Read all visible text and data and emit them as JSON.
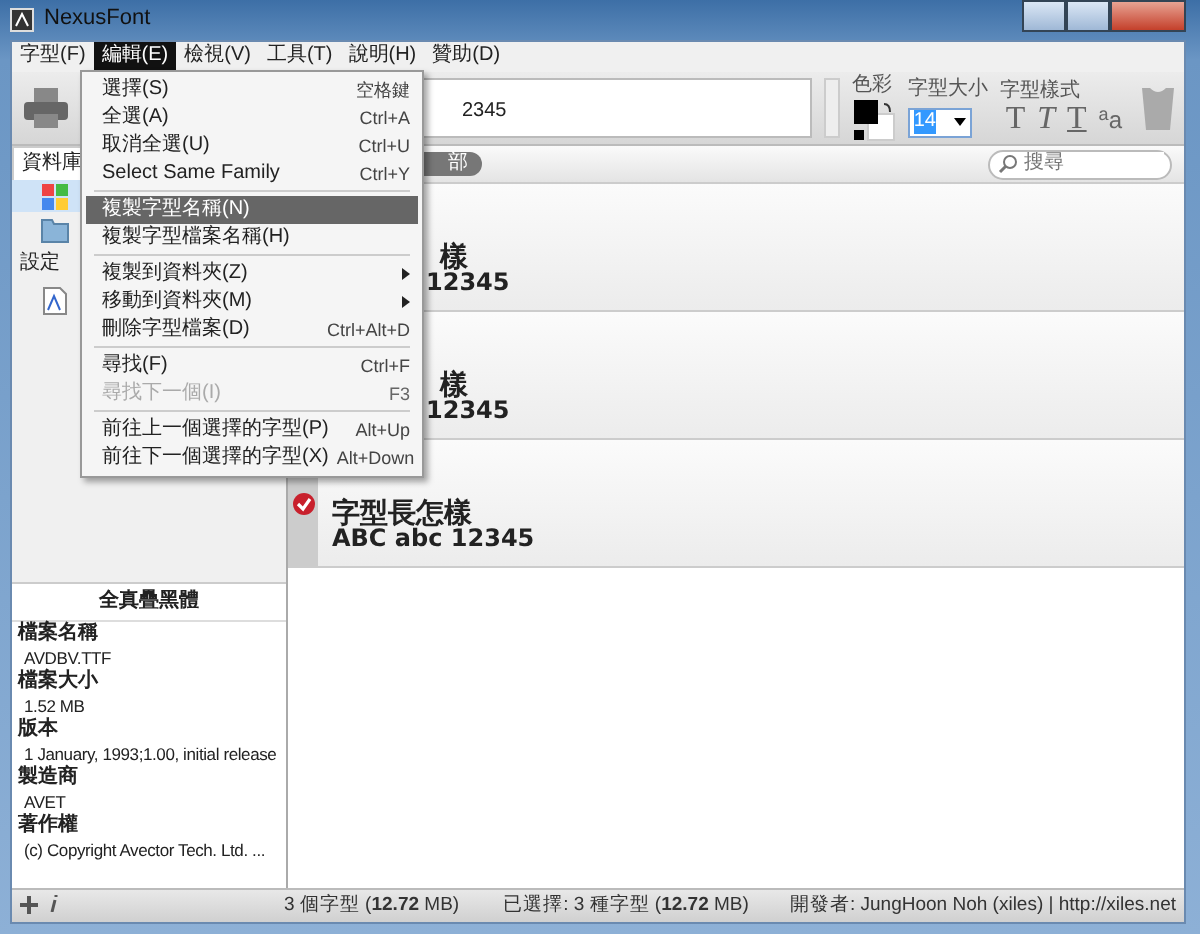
{
  "window": {
    "title": "NexusFont"
  },
  "menubar": [
    {
      "label": "字型(F)",
      "selected": false
    },
    {
      "label": "編輯(E)",
      "selected": true
    },
    {
      "label": "檢視(V)",
      "selected": false
    },
    {
      "label": "工具(T)",
      "selected": false
    },
    {
      "label": "說明(H)",
      "selected": false
    },
    {
      "label": "贊助(D)",
      "selected": false
    }
  ],
  "edit_menu": [
    {
      "kind": "item",
      "label": "選擇(S)",
      "shortcut": "空格鍵",
      "submenu": false,
      "disabled": false,
      "selected": false
    },
    {
      "kind": "item",
      "label": "全選(A)",
      "shortcut": "Ctrl+A",
      "submenu": false,
      "disabled": false,
      "selected": false
    },
    {
      "kind": "item",
      "label": "取消全選(U)",
      "shortcut": "Ctrl+U",
      "submenu": false,
      "disabled": false,
      "selected": false
    },
    {
      "kind": "item",
      "label": "Select Same Family",
      "shortcut": "Ctrl+Y",
      "submenu": false,
      "disabled": false,
      "selected": false
    },
    {
      "kind": "separator"
    },
    {
      "kind": "item",
      "label": "複製字型名稱(N)",
      "submenu": false,
      "disabled": false,
      "selected": true
    },
    {
      "kind": "item",
      "label": "複製字型檔案名稱(H)",
      "submenu": false,
      "disabled": false,
      "selected": false
    },
    {
      "kind": "separator"
    },
    {
      "kind": "item",
      "label": "複製到資料夾(Z)",
      "submenu": true,
      "disabled": false,
      "selected": false
    },
    {
      "kind": "item",
      "label": "移動到資料夾(M)",
      "submenu": true,
      "disabled": false,
      "selected": false
    },
    {
      "kind": "item",
      "label": "刪除字型檔案(D)",
      "shortcut": "Ctrl+Alt+D",
      "submenu": false,
      "disabled": false,
      "selected": false
    },
    {
      "kind": "separator"
    },
    {
      "kind": "item",
      "label": "尋找(F)",
      "shortcut": "Ctrl+F",
      "submenu": false,
      "disabled": false,
      "selected": false
    },
    {
      "kind": "item",
      "label": "尋找下一個(I)",
      "shortcut": "F3",
      "submenu": false,
      "disabled": true,
      "selected": false
    },
    {
      "kind": "separator"
    },
    {
      "kind": "item",
      "label": "前往上一個選擇的字型(P)",
      "shortcut": "Alt+Up",
      "submenu": false,
      "disabled": false,
      "selected": false
    },
    {
      "kind": "item",
      "label": "前往下一個選擇的字型(X)",
      "shortcut": "Alt+Down",
      "submenu": false,
      "disabled": false,
      "selected": false
    }
  ],
  "toolbar": {
    "sample_text": "2345",
    "color_label": "色彩",
    "size_label": "字型大小",
    "size_value": "14",
    "style_label": "字型樣式",
    "style_buttons": [
      {
        "label": "T",
        "kind": "serif"
      },
      {
        "label": "T",
        "kind": "italic"
      },
      {
        "label": "T",
        "kind": "underline"
      },
      {
        "label": "$^{a}$a",
        "kind": "case"
      }
    ]
  },
  "library": {
    "tab": "資料庫",
    "items": [
      {
        "kind": "windows",
        "selected": true
      },
      {
        "kind": "folder",
        "selected": false
      }
    ],
    "settings_tab": "設定",
    "settings_items": [
      {
        "kind": "font-file"
      }
    ]
  },
  "filter": {
    "pill": "部",
    "search_placeholder": "搜尋"
  },
  "fonts": [
    {
      "sample_cjk": "樣",
      "sample_latin": "12345"
    },
    {
      "sample_cjk": "樣",
      "sample_latin": "12345"
    },
    {
      "sample_cjk": "字型長怎樣",
      "sample_latin": "ABC abc 12345",
      "checked": true
    }
  ],
  "font_info": {
    "title": "全真疊黑體",
    "properties": [
      {
        "label": "檔案名稱",
        "value": "AVDBV.TTF"
      },
      {
        "label": "檔案大小",
        "value": "1.52 MB"
      },
      {
        "label": "版本",
        "value": "1 January, 1993;1.00, initial release"
      },
      {
        "label": "製造商",
        "value": "AVET"
      },
      {
        "label": "著作權",
        "value": "(c) Copyright Avector Tech. Ltd. ..."
      }
    ]
  },
  "status_bar": {
    "total": "3 個字型 (**12.72** MB)",
    "selected": "已選擇: 3 種字型 (**12.72** MB)",
    "credit": "開發者: JungHoon Noh (xiles) | http://xiles.net"
  }
}
